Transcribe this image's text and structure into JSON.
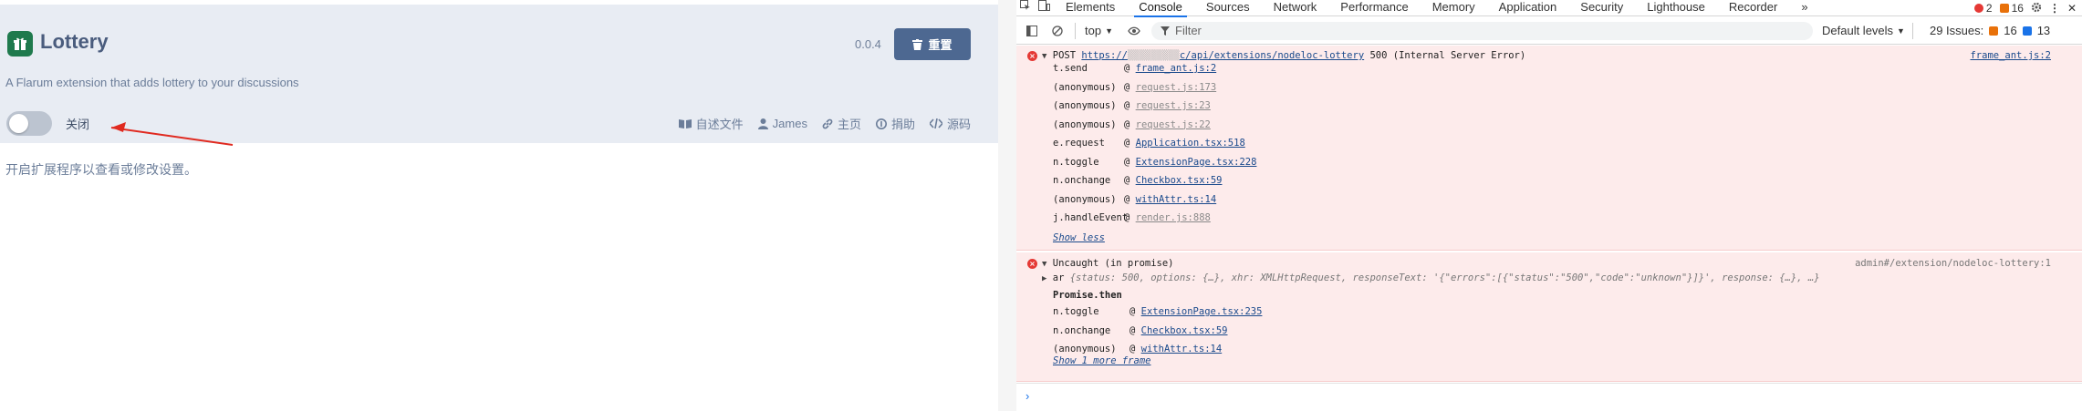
{
  "extension": {
    "title": "Lottery",
    "version": "0.0.4",
    "reset_label": "重置",
    "description": "A Flarum extension that adds lottery to your discussions",
    "toggle_label": "关闭",
    "toggle_on": false,
    "links": [
      {
        "icon": "book-icon",
        "label": "自述文件"
      },
      {
        "icon": "user-icon",
        "label": "James"
      },
      {
        "icon": "link-icon",
        "label": "主页"
      },
      {
        "icon": "donate-icon",
        "label": "捐助"
      },
      {
        "icon": "code-icon",
        "label": "源码"
      }
    ],
    "notice": "开启扩展程序以查看或修改设置。"
  },
  "devtools": {
    "tabs": [
      "Elements",
      "Console",
      "Sources",
      "Network",
      "Performance",
      "Memory",
      "Application",
      "Security",
      "Lighthouse",
      "Recorder",
      "»"
    ],
    "active_tab": "Console",
    "error_count": "2",
    "warning_count": "16",
    "toolbar": {
      "context": "top",
      "filter_placeholder": "Filter",
      "levels": "Default levels",
      "issues_label": "29 Issues:",
      "issues_warn": "16",
      "issues_info": "13"
    },
    "message1": {
      "method": "POST",
      "url": "https://",
      "url_rest": "c/api/extensions/nodeloc-lottery",
      "status": "500 (Internal Server Error)",
      "source": "frame_ant.js:2",
      "stack": [
        {
          "fn": "t.send",
          "src": "frame_ant.js:2",
          "muted": false
        },
        {
          "fn": "(anonymous)",
          "src": "request.js:173",
          "muted": true
        },
        {
          "fn": "(anonymous)",
          "src": "request.js:23",
          "muted": true
        },
        {
          "fn": "(anonymous)",
          "src": "request.js:22",
          "muted": true
        },
        {
          "fn": "e.request",
          "src": "Application.tsx:518",
          "muted": false
        },
        {
          "fn": "n.toggle",
          "src": "ExtensionPage.tsx:228",
          "muted": false
        },
        {
          "fn": "n.onchange",
          "src": "Checkbox.tsx:59",
          "muted": false
        },
        {
          "fn": "(anonymous)",
          "src": "withAttr.ts:14",
          "muted": false
        },
        {
          "fn": "j.handleEvent",
          "src": "render.js:888",
          "muted": true
        }
      ],
      "show_less": "Show less"
    },
    "message2": {
      "title": "Uncaught (in promise)",
      "source": "admin#/extension/nodeloc-lottery:1",
      "object_prefix": "ar",
      "object_body": "{status: 500, options: {…}, xhr: XMLHttpRequest, responseText: '{\"errors\":[{\"status\":\"500\",\"code\":\"unknown\"}]}', response: {…}, …}",
      "promise_then": "Promise.then",
      "stack": [
        {
          "fn": "n.toggle",
          "src": "ExtensionPage.tsx:235"
        },
        {
          "fn": "n.onchange",
          "src": "Checkbox.tsx:59"
        },
        {
          "fn": "(anonymous)",
          "src": "withAttr.ts:14"
        }
      ],
      "show_more": "Show 1 more frame"
    },
    "prompt_symbol": "›"
  }
}
